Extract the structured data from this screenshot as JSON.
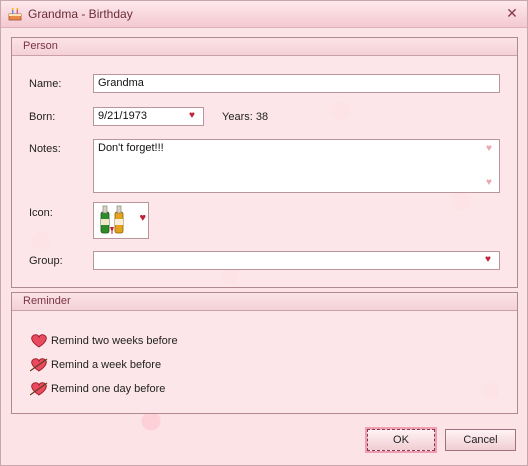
{
  "window": {
    "title": "Grandma - Birthday"
  },
  "person": {
    "group_title": "Person",
    "name_label": "Name:",
    "name_value": "Grandma",
    "born_label": "Born:",
    "born_value": "9/21/1973",
    "years_text": "Years: 38",
    "notes_label": "Notes:",
    "notes_value": "Don't forget!!!",
    "icon_label": "Icon:",
    "group_label": "Group:",
    "group_value": ""
  },
  "reminder": {
    "group_title": "Reminder",
    "items": [
      {
        "label": "Remind two weeks before",
        "icon": "heart-icon"
      },
      {
        "label": "Remind a week before",
        "icon": "heart-arrow-icon"
      },
      {
        "label": "Remind one day before",
        "icon": "heart-arrow-icon"
      }
    ]
  },
  "buttons": {
    "ok": "OK",
    "cancel": "Cancel"
  }
}
